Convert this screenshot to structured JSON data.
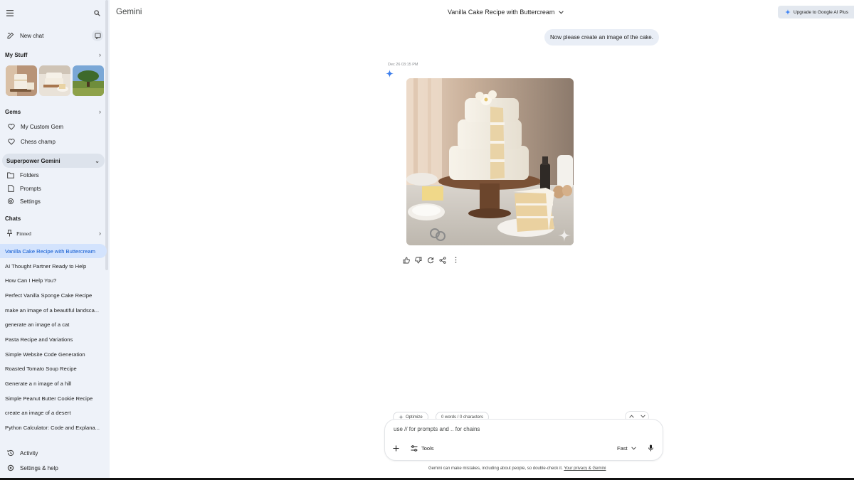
{
  "app": {
    "brand": "Gemini"
  },
  "header": {
    "chat_title": "Vanilla Cake Recipe with Buttercream",
    "upgrade_label": "Upgrade to Google AI Plus"
  },
  "sidebar": {
    "new_chat_label": "New chat",
    "my_stuff_label": "My Stuff",
    "gems_label": "Gems",
    "gems": [
      "My Custom Gem",
      "Chess champ"
    ],
    "superpower_label": "Superpower Gemini",
    "superpower_items": [
      "Folders",
      "Prompts",
      "Settings"
    ],
    "chats_label": "Chats",
    "pinned_label": "Pinned",
    "chats": [
      "Vanilla Cake Recipe with Buttercream",
      "AI Thought Partner Ready to Help",
      "How Can I Help You?",
      "Perfect Vanilla Sponge Cake Recipe",
      "make an image of a beautiful landsca...",
      "generate an image of a cat",
      "Pasta Recipe and Variations",
      "Simple Website Code Generation",
      "Roasted Tomato Soup Recipe",
      "Generate a n image of a hill",
      "Simple Peanut Butter Cookie Recipe",
      "create an image of a desert",
      "Python Calculator: Code and Explana..."
    ],
    "activity_label": "Activity",
    "settings_help_label": "Settings & help"
  },
  "conversation": {
    "user_message": "Now please create an image of the cake.",
    "response_timestamp": "Dec 26 03:15 PM"
  },
  "composer": {
    "optimize_label": "Optimize",
    "counter_label": "0 words / 0 characters",
    "placeholder": "use // for prompts and .. for chains",
    "tools_label": "Tools",
    "mode_label": "Fast"
  },
  "footer": {
    "disclaimer": "Gemini can make mistakes, including about people, so double-check it.",
    "privacy_link": "Your privacy & Gemini"
  },
  "colors": {
    "sidebar_bg": "#eef2f9",
    "active_chat_bg": "#d3e3fd",
    "accent": "#0b57d0",
    "user_bubble_bg": "#e9eef6"
  }
}
